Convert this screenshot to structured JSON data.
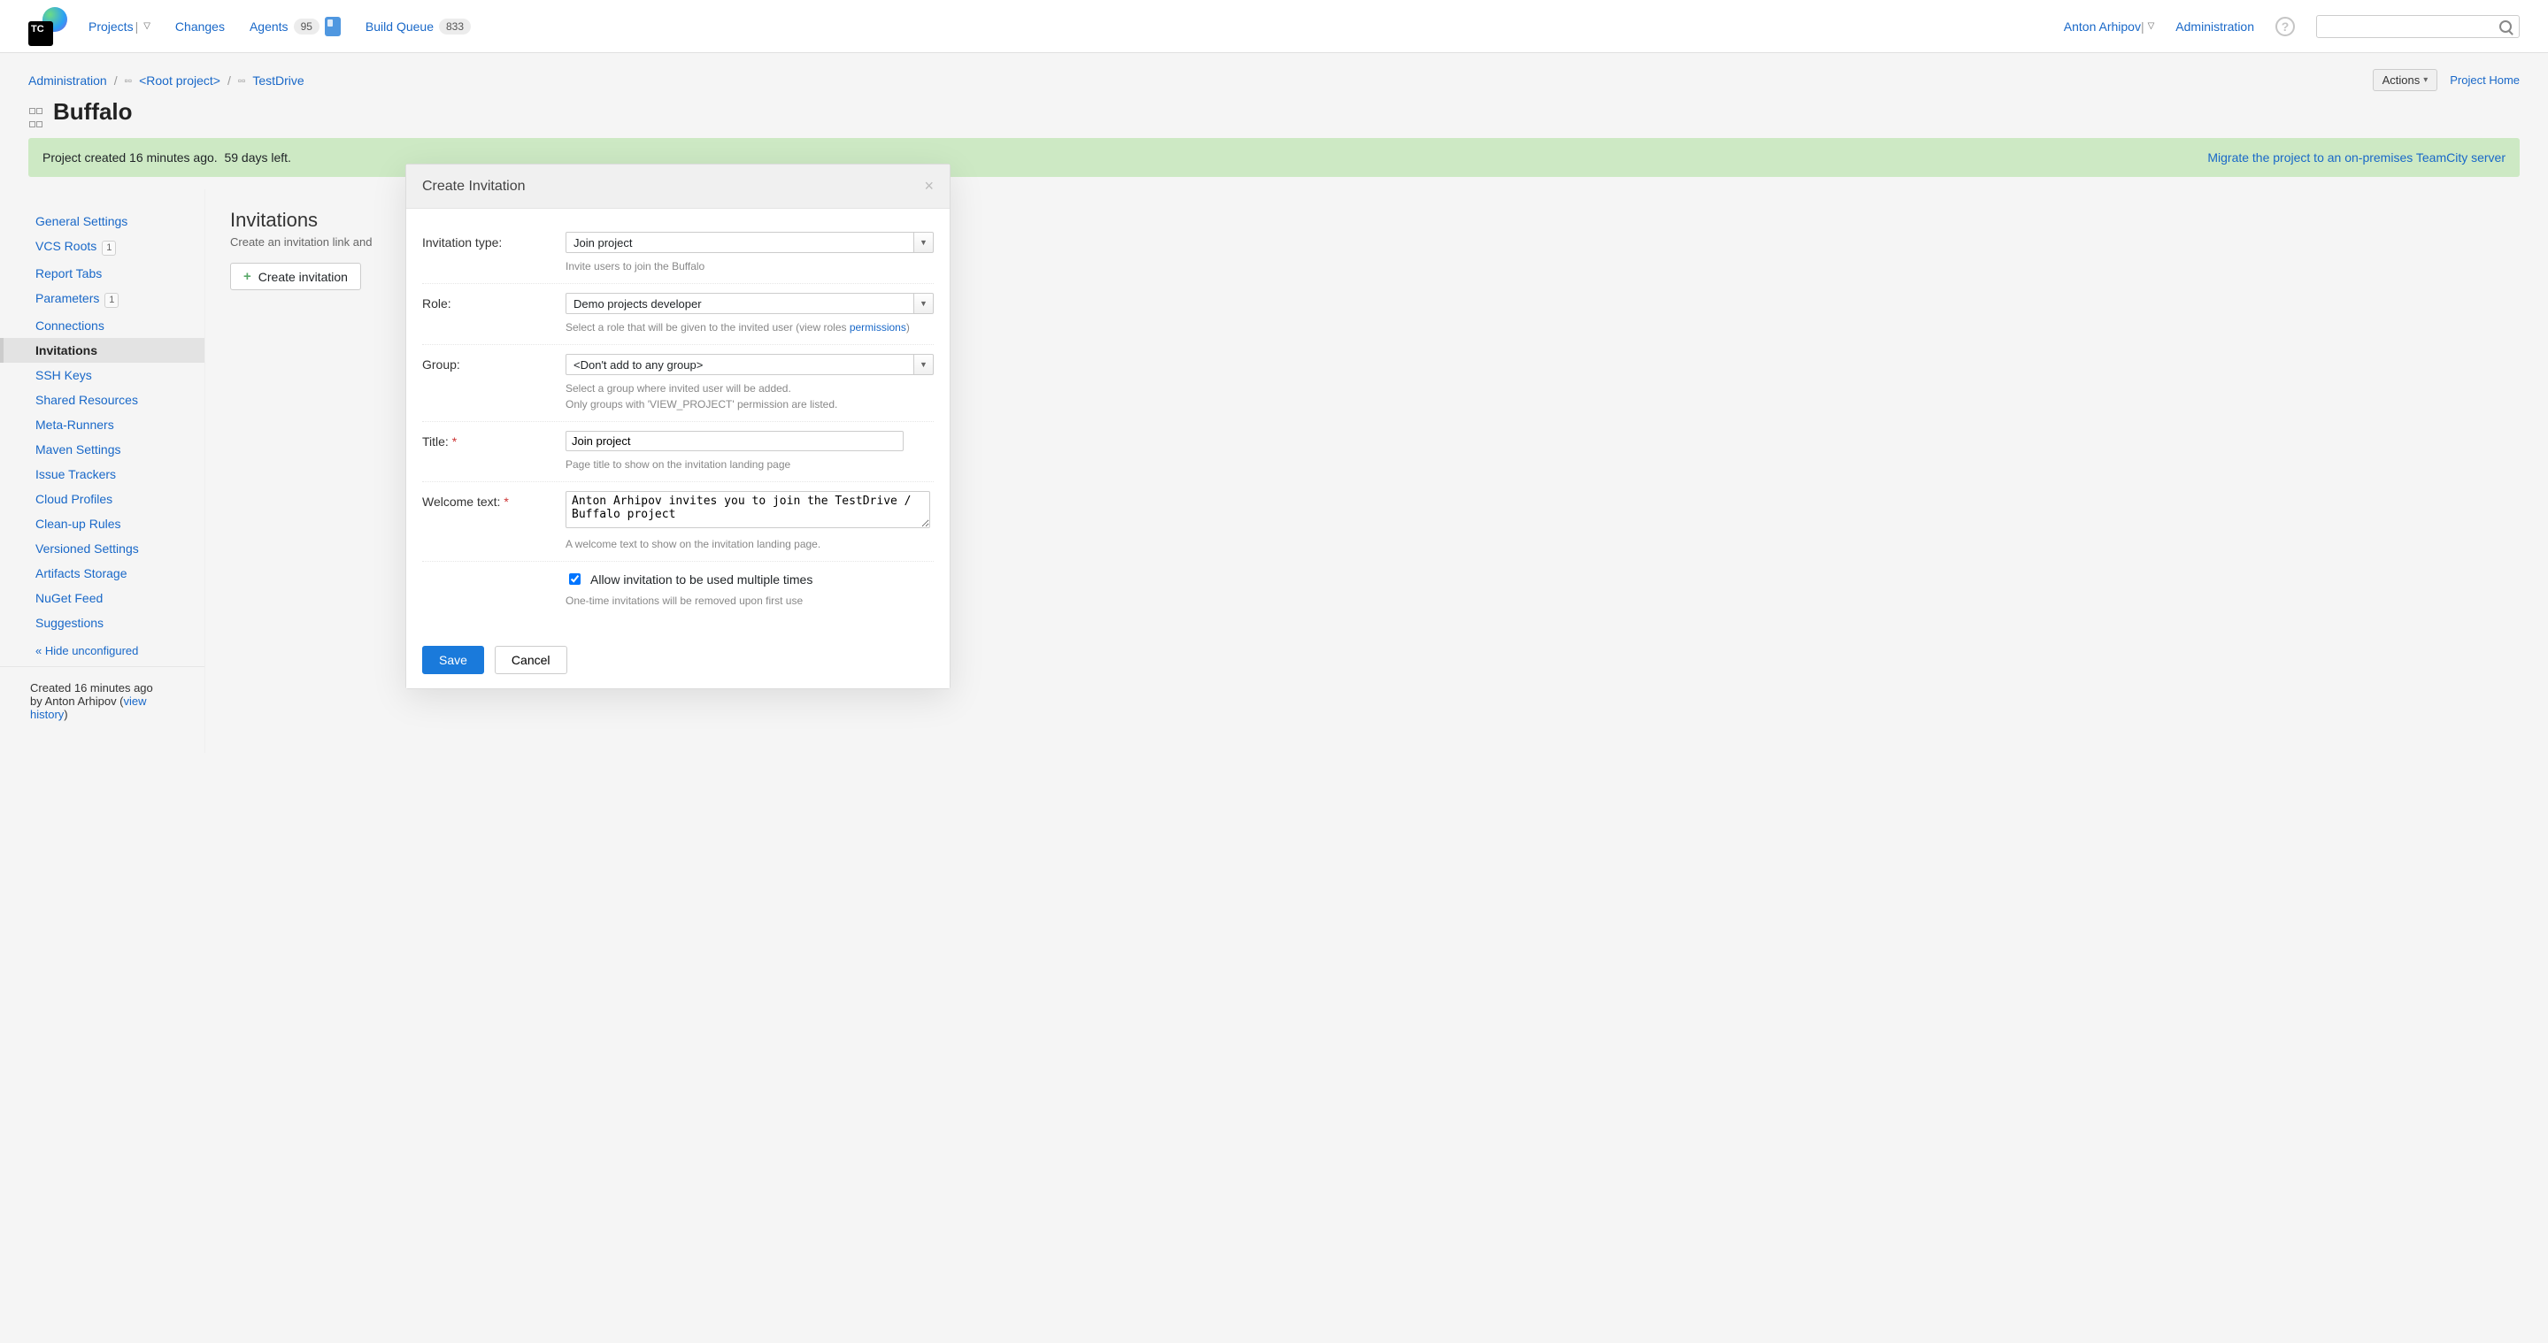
{
  "topnav": {
    "projects": "Projects",
    "changes": "Changes",
    "agents": "Agents",
    "agents_count": "95",
    "build_queue": "Build Queue",
    "build_queue_count": "833",
    "user": "Anton Arhipov",
    "administration": "Administration"
  },
  "breadcrumb": {
    "admin": "Administration",
    "root": "<Root project>",
    "proj": "TestDrive"
  },
  "header": {
    "actions": "Actions",
    "project_home": "Project Home",
    "title": "Buffalo"
  },
  "notice": {
    "left1": "Project created 16 minutes ago.",
    "left2": "59 days left.",
    "link": "Migrate the project to an on-premises TeamCity server"
  },
  "sidebar": {
    "items": [
      {
        "label": "General Settings"
      },
      {
        "label": "VCS Roots",
        "badge": "1"
      },
      {
        "label": "Report Tabs"
      },
      {
        "label": "Parameters",
        "badge": "1"
      },
      {
        "label": "Connections"
      },
      {
        "label": "Invitations",
        "active": true
      },
      {
        "label": "SSH Keys"
      },
      {
        "label": "Shared Resources"
      },
      {
        "label": "Meta-Runners"
      },
      {
        "label": "Maven Settings"
      },
      {
        "label": "Issue Trackers"
      },
      {
        "label": "Cloud Profiles"
      },
      {
        "label": "Clean-up Rules"
      },
      {
        "label": "Versioned Settings"
      },
      {
        "label": "Artifacts Storage"
      },
      {
        "label": "NuGet Feed"
      },
      {
        "label": "Suggestions"
      }
    ],
    "hide": "« Hide unconfigured",
    "footer": {
      "line1": "Created 16 minutes ago",
      "line2a": "by Anton Arhipov  (",
      "link": "view history",
      "line2b": ")"
    }
  },
  "content": {
    "title": "Invitations",
    "sub": "Create an invitation link and",
    "create_btn": "Create invitation"
  },
  "modal": {
    "title": "Create Invitation",
    "fields": {
      "type_label": "Invitation type:",
      "type_value": "Join project",
      "type_hint": "Invite users to join the Buffalo",
      "role_label": "Role:",
      "role_value": "Demo projects developer",
      "role_hint": "Select a role that will be given to the invited user (view roles ",
      "role_hint_link": "permissions",
      "role_hint_end": ")",
      "group_label": "Group:",
      "group_value": "<Don't add to any group>",
      "group_hint1": "Select a group where invited user will be added.",
      "group_hint2": "Only groups with 'VIEW_PROJECT' permission are listed.",
      "title_label": "Title:",
      "title_value": "Join project",
      "title_hint": "Page title to show on the invitation landing page",
      "welcome_label": "Welcome text:",
      "welcome_value": "Anton Arhipov invites you to join the TestDrive / Buffalo project",
      "welcome_hint": "A welcome text to show on the invitation landing page.",
      "multi_label": "Allow invitation to be used multiple times",
      "multi_hint": "One-time invitations will be removed upon first use"
    },
    "save": "Save",
    "cancel": "Cancel"
  }
}
